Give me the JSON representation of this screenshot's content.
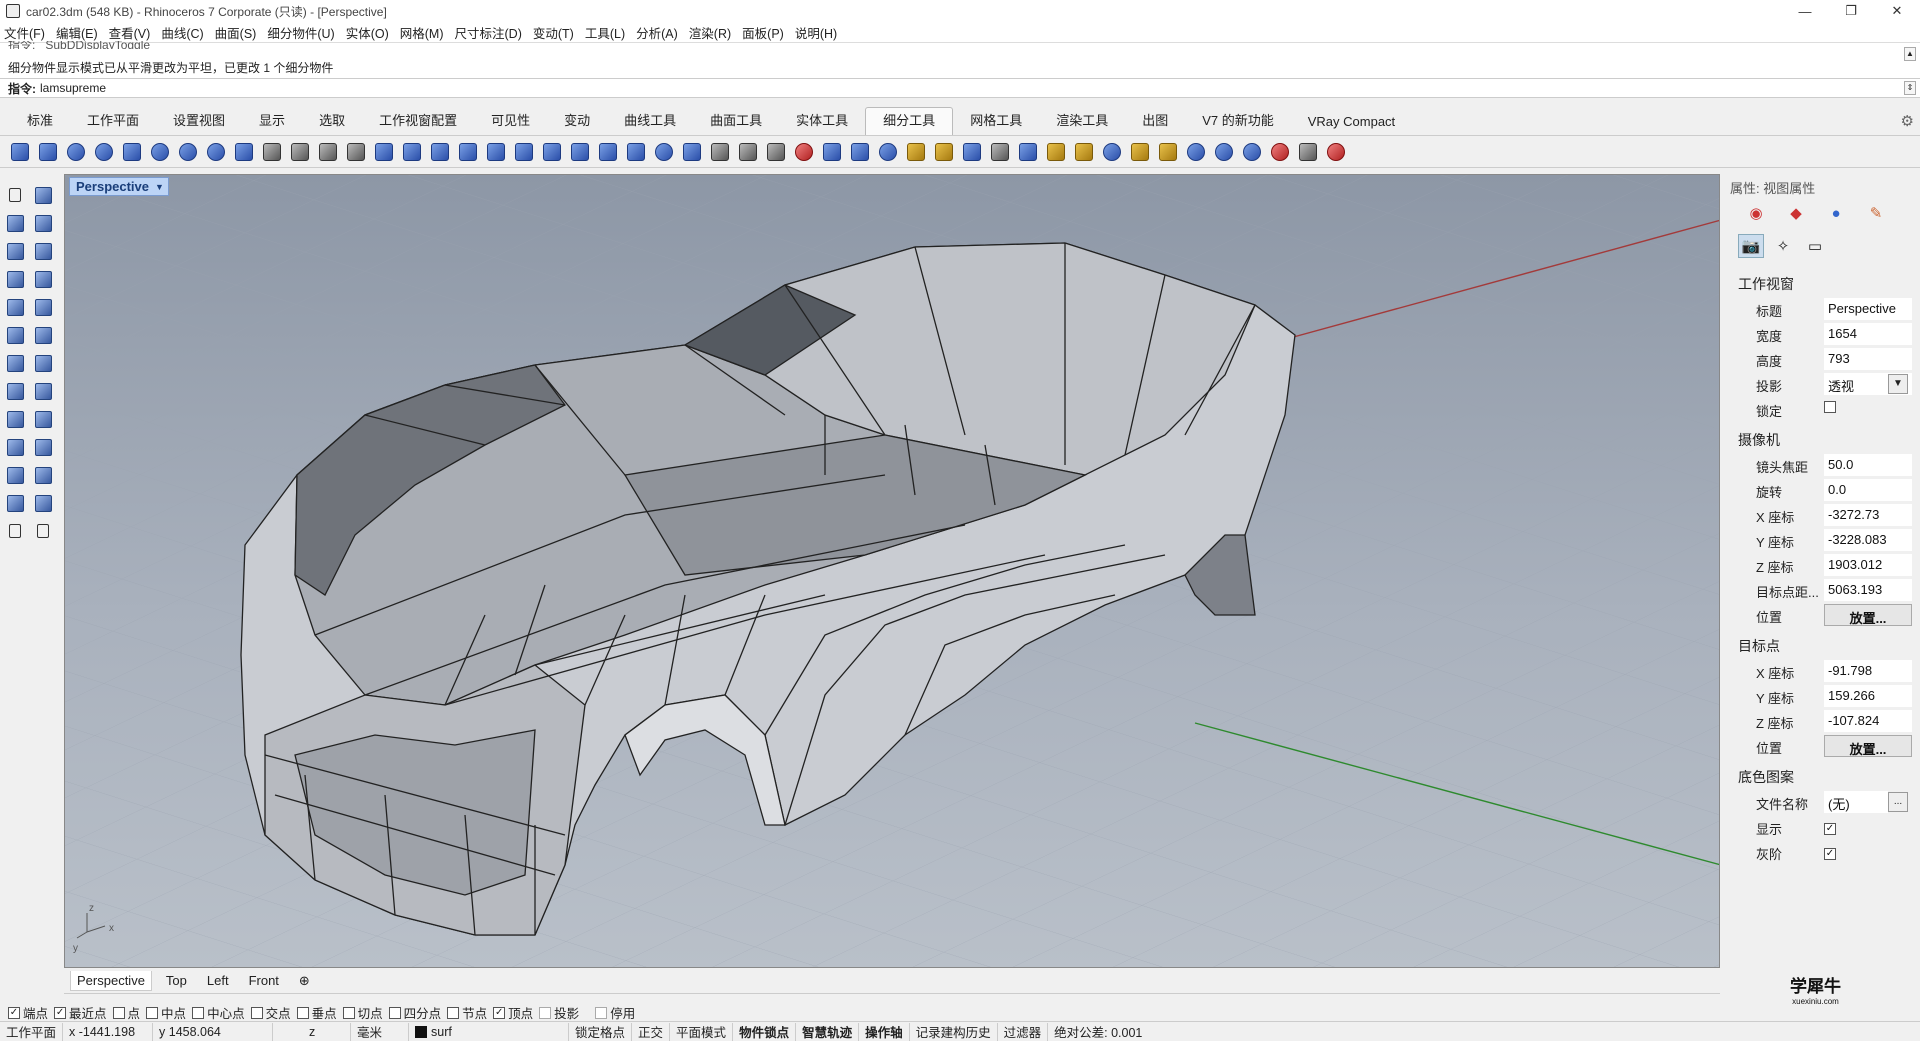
{
  "window": {
    "title": "car02.3dm (548 KB) - Rhinoceros 7 Corporate (只读) - [Perspective]",
    "controls": [
      "—",
      "❐",
      "✕"
    ]
  },
  "menu": [
    "文件(F)",
    "编辑(E)",
    "查看(V)",
    "曲线(C)",
    "曲面(S)",
    "细分物件(U)",
    "实体(O)",
    "网格(M)",
    "尺寸标注(D)",
    "变动(T)",
    "工具(L)",
    "分析(A)",
    "渲染(R)",
    "面板(P)",
    "说明(H)"
  ],
  "command": {
    "history_top": "指令: _SubDDisplayToggle",
    "history_line": "细分物件显示模式已从平滑更改为平坦，已更改 1 个细分物件",
    "prompt_label": "指令:",
    "prompt_value": "lamsupreme"
  },
  "toolbar_tabs": [
    "标准",
    "工作平面",
    "设置视图",
    "显示",
    "选取",
    "工作视窗配置",
    "可见性",
    "变动",
    "曲线工具",
    "曲面工具",
    "实体工具",
    "细分工具",
    "网格工具",
    "渲染工具",
    "出图",
    "V7 的新功能",
    "VRay Compact"
  ],
  "active_tab": "细分工具",
  "viewport": {
    "title": "Perspective",
    "axis_labels": {
      "x": "x",
      "y": "y",
      "z": "z"
    }
  },
  "viewport_tabs": [
    "Perspective",
    "Top",
    "Left",
    "Front",
    "⊕"
  ],
  "osnaps": [
    {
      "label": "端点",
      "checked": true
    },
    {
      "label": "最近点",
      "checked": true
    },
    {
      "label": "点",
      "checked": false
    },
    {
      "label": "中点",
      "checked": false
    },
    {
      "label": "中心点",
      "checked": false
    },
    {
      "label": "交点",
      "checked": false
    },
    {
      "label": "垂点",
      "checked": false
    },
    {
      "label": "切点",
      "checked": false
    },
    {
      "label": "四分点",
      "checked": false
    },
    {
      "label": "节点",
      "checked": false
    },
    {
      "label": "顶点",
      "checked": true
    },
    {
      "label": "投影",
      "checked": false,
      "disabled": true
    },
    {
      "label": "停用",
      "checked": false,
      "disabled": true
    }
  ],
  "status": {
    "cplane": "工作平面",
    "x": "x -1441.198",
    "y": "y 1458.064",
    "z": "z",
    "units": "毫米",
    "layer": "surf",
    "grid_snap": "锁定格点",
    "ortho": "正交",
    "planar": "平面模式",
    "osnap": "物件锁点",
    "smarttrack": "智慧轨迹",
    "gumball": "操作轴",
    "history": "记录建构历史",
    "filter": "过滤器",
    "tolerance": "绝对公差: 0.001"
  },
  "properties": {
    "panel_title": "属性: 视图属性",
    "viewport_section": "工作视窗",
    "camera_section": "摄像机",
    "target_section": "目标点",
    "wallpaper_section": "底色图案",
    "rows": {
      "title_k": "标题",
      "title_v": "Perspective",
      "width_k": "宽度",
      "width_v": "1654",
      "height_k": "高度",
      "height_v": "793",
      "proj_k": "投影",
      "proj_v": "透视",
      "lock_k": "锁定",
      "lens_k": "镜头焦距",
      "lens_v": "50.0",
      "rot_k": "旋转",
      "rot_v": "0.0",
      "cx_k": "X 座标",
      "cx_v": "-3272.73",
      "cy_k": "Y 座标",
      "cy_v": "-3228.083",
      "cz_k": "Z 座标",
      "cz_v": "1903.012",
      "dist_k": "目标点距...",
      "dist_v": "5063.193",
      "cpos_k": "位置",
      "cpos_v": "放置...",
      "tx_k": "X 座标",
      "tx_v": "-91.798",
      "ty_k": "Y 座标",
      "ty_v": "159.266",
      "tz_k": "Z 座标",
      "tz_v": "-107.824",
      "tpos_k": "位置",
      "tpos_v": "放置...",
      "file_k": "文件名称",
      "file_v": "(无)",
      "show_k": "显示",
      "gray_k": "灰阶"
    }
  },
  "watermark": {
    "main": "学犀牛",
    "sub": "xuexiniu.com"
  }
}
